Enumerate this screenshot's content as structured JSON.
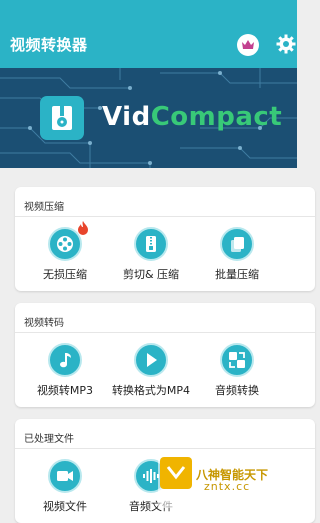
{
  "appbar": {
    "title": "视频转换器",
    "crown_icon": "crown-icon",
    "settings_icon": "gear-icon"
  },
  "banner": {
    "brand_part1": "Vid",
    "brand_part2": "Compact",
    "logo_icon": "film-zip-icon"
  },
  "sections": [
    {
      "title": "视频压缩",
      "items": [
        {
          "label": "无损压缩",
          "icon": "film-reel-icon"
        },
        {
          "label": "剪切& 压缩",
          "icon": "zip-icon"
        },
        {
          "label": "批量压缩",
          "icon": "stack-icon"
        }
      ]
    },
    {
      "title": "视频转码",
      "items": [
        {
          "label": "视频转MP3",
          "icon": "music-note-icon"
        },
        {
          "label": "转换格式为MP4",
          "icon": "play-icon"
        },
        {
          "label": "音频转换",
          "icon": "audio-convert-icon"
        }
      ]
    },
    {
      "title": "已处理文件",
      "items": [
        {
          "label": "视频文件",
          "icon": "video-file-icon"
        },
        {
          "label": "音频文件",
          "icon": "audio-file-icon"
        }
      ]
    }
  ],
  "watermark": {
    "line1": "八神智能天下",
    "line2": "zntx.cc"
  },
  "colors": {
    "primary": "#2bb3c6",
    "brand_green": "#38c978",
    "crown": "#c2408f",
    "flame": "#e8452c"
  }
}
